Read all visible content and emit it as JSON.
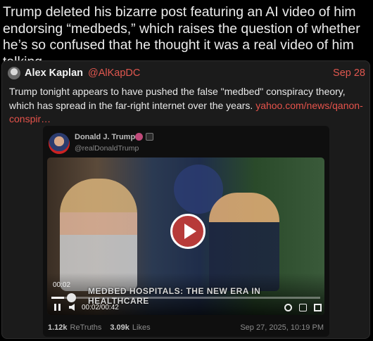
{
  "post": {
    "text": "Trump deleted his bizarre post featuring an AI video of him endorsing “medbeds,” which raises the question of whether he’s so confused that he thought it was a real video of him talking"
  },
  "quote": {
    "author_name": "Alex Kaplan",
    "author_handle": "@AlKapDC",
    "date": "Sep 28",
    "body_text": "Trump tonight appears to have pushed the false \"medbed\" conspiracy theory, which has spread in the far-right internet over the years. ",
    "link_text": "yahoo.com/news/qanon-conspir…",
    "colors": {
      "link": "#e5534b",
      "card_bg": "#1b1b1b"
    }
  },
  "embed": {
    "author_name": "Donald J. Trump",
    "author_handle": "@realDonaldTrump",
    "video": {
      "chyron": "MEDBED HOSPITALS: THE NEW ERA IN HEALTHCARE",
      "elapsed_overlay": "00:02",
      "time_display": "00:02/00:42",
      "progress": 0.048,
      "icons": [
        "play-icon",
        "pause-icon",
        "volume-icon",
        "settings-icon",
        "pip-icon",
        "fullscreen-icon"
      ]
    },
    "stats": {
      "retruths_count": "1.12k",
      "retruths_label": "ReTruths",
      "likes_count": "3.09k",
      "likes_label": "Likes",
      "timestamp": "Sep 27, 2025, 10:19 PM"
    }
  }
}
